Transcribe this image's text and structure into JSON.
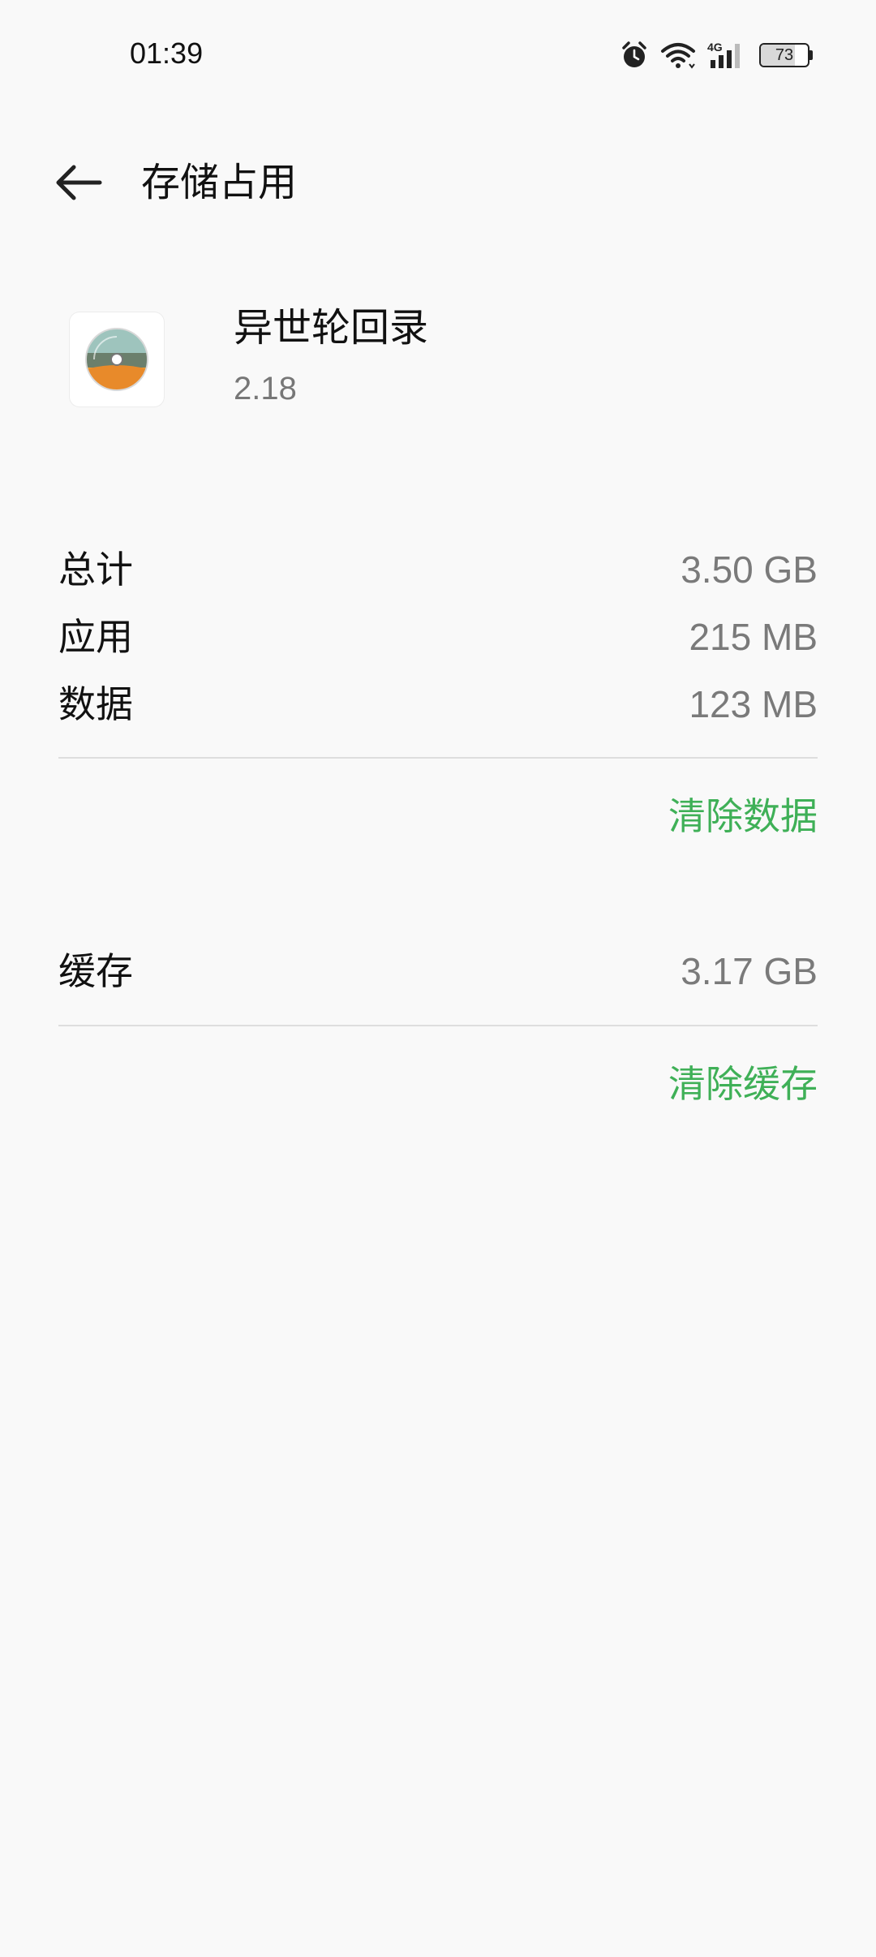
{
  "status_bar": {
    "time": "01:39",
    "battery_level": "73",
    "battery_fraction": 0.73,
    "network_type": "4G",
    "icons": [
      "alarm-icon",
      "wifi-icon",
      "cellular-4g-icon",
      "battery-icon"
    ]
  },
  "header": {
    "title": "存储占用",
    "back_icon": "back-arrow-icon"
  },
  "app": {
    "name": "异世轮回录",
    "version": "2.18"
  },
  "storage": {
    "total_label": "总计",
    "total_value": "3.50 GB",
    "app_label": "应用",
    "app_value": "215 MB",
    "data_label": "数据",
    "data_value": "123 MB",
    "clear_data_label": "清除数据"
  },
  "cache": {
    "label": "缓存",
    "value": "3.17 GB",
    "clear_cache_label": "清除缓存"
  },
  "colors": {
    "accent": "#3fb057",
    "background": "#f9f9f9",
    "secondary_text": "#7a7a7a"
  }
}
